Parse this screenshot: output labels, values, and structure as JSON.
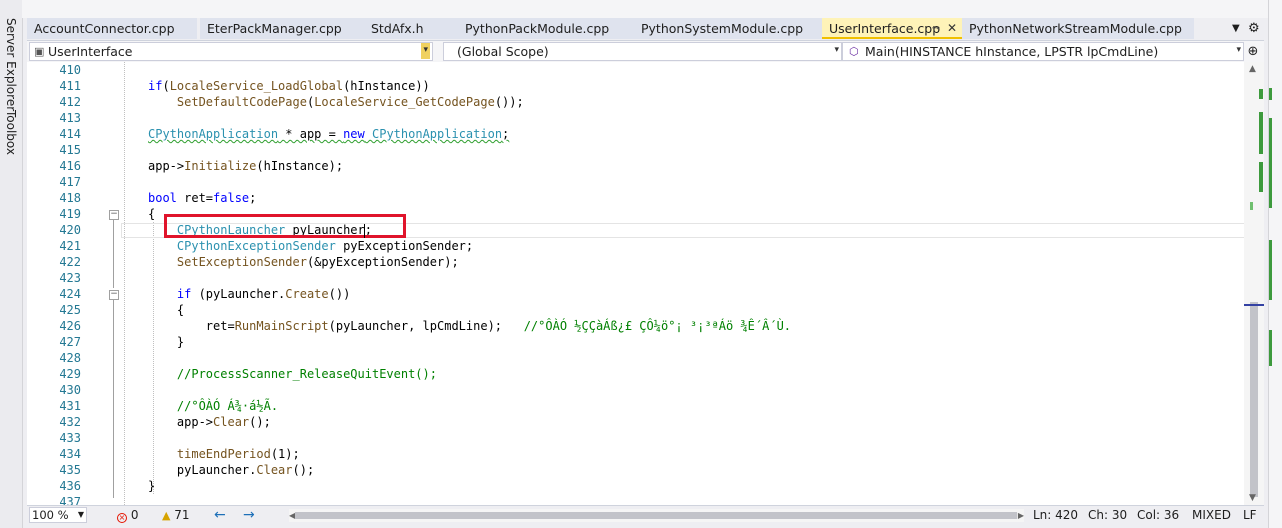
{
  "left_dock": {
    "server_explorer": "Server Explorer",
    "toolbox": "Toolbox"
  },
  "tabs": [
    {
      "label": "AccountConnector.cpp",
      "active": false
    },
    {
      "label": "EterPackManager.cpp",
      "active": false
    },
    {
      "label": "StdAfx.h",
      "active": false
    },
    {
      "label": "PythonPackModule.cpp",
      "active": false
    },
    {
      "label": "PythonSystemModule.cpp",
      "active": false
    },
    {
      "label": "UserInterface.cpp",
      "active": true,
      "pin": "⊸",
      "close": "✕"
    },
    {
      "label": "PythonNetworkStreamModule.cpp",
      "active": false
    }
  ],
  "navbar": {
    "project": "UserInterface",
    "scope": "(Global Scope)",
    "member": "Main(HINSTANCE hInstance, LPSTR lpCmdLine)"
  },
  "lines": [
    {
      "num": "410",
      "code": ""
    },
    {
      "num": "411",
      "code": "if(LocaleService_LoadGlobal(hInstance))"
    },
    {
      "num": "412",
      "code": "    SetDefaultCodePage(LocaleService_GetCodePage());"
    },
    {
      "num": "413",
      "code": ""
    },
    {
      "num": "414",
      "code": "CPythonApplication * app = new CPythonApplication;"
    },
    {
      "num": "415",
      "code": ""
    },
    {
      "num": "416",
      "code": "app->Initialize(hInstance);"
    },
    {
      "num": "417",
      "code": ""
    },
    {
      "num": "418",
      "code": "bool ret=false;"
    },
    {
      "num": "419",
      "code": "{"
    },
    {
      "num": "420",
      "code": "    CPythonLauncher pyLauncher;"
    },
    {
      "num": "421",
      "code": "    CPythonExceptionSender pyExceptionSender;"
    },
    {
      "num": "422",
      "code": "    SetExceptionSender(&pyExceptionSender);"
    },
    {
      "num": "423",
      "code": ""
    },
    {
      "num": "424",
      "code": "    if (pyLauncher.Create())"
    },
    {
      "num": "425",
      "code": "    {"
    },
    {
      "num": "426",
      "code": "        ret=RunMainScript(pyLauncher, lpCmdLine);   //°ÔÀÓ ½ÇÇàÁß¿£ ÇÔ¼ö°¡ ³¡³ªÁö ¾Ê´Â´Ù."
    },
    {
      "num": "427",
      "code": "    }"
    },
    {
      "num": "428",
      "code": ""
    },
    {
      "num": "429",
      "code": "    //ProcessScanner_ReleaseQuitEvent();"
    },
    {
      "num": "430",
      "code": ""
    },
    {
      "num": "431",
      "code": "    //°ÔÀÓ Á¾·á½Ã."
    },
    {
      "num": "432",
      "code": "    app->Clear();"
    },
    {
      "num": "433",
      "code": ""
    },
    {
      "num": "434",
      "code": "    timeEndPeriod(1);"
    },
    {
      "num": "435",
      "code": "    pyLauncher.Clear();"
    },
    {
      "num": "436",
      "code": "}"
    },
    {
      "num": "437",
      "code": ""
    }
  ],
  "status": {
    "zoom": "100 %",
    "errors": "0",
    "warnings": "71",
    "ln": "Ln: 420",
    "ch": "Ch: 30",
    "col": "Col: 36",
    "mixed": "MIXED",
    "eol": "LF"
  },
  "colors": {
    "keyword": "#0000ff",
    "type": "#2b91af",
    "function": "#74531f",
    "comment": "#008000",
    "highlight_box": "#e0142b",
    "active_tab": "#fef3b8"
  }
}
